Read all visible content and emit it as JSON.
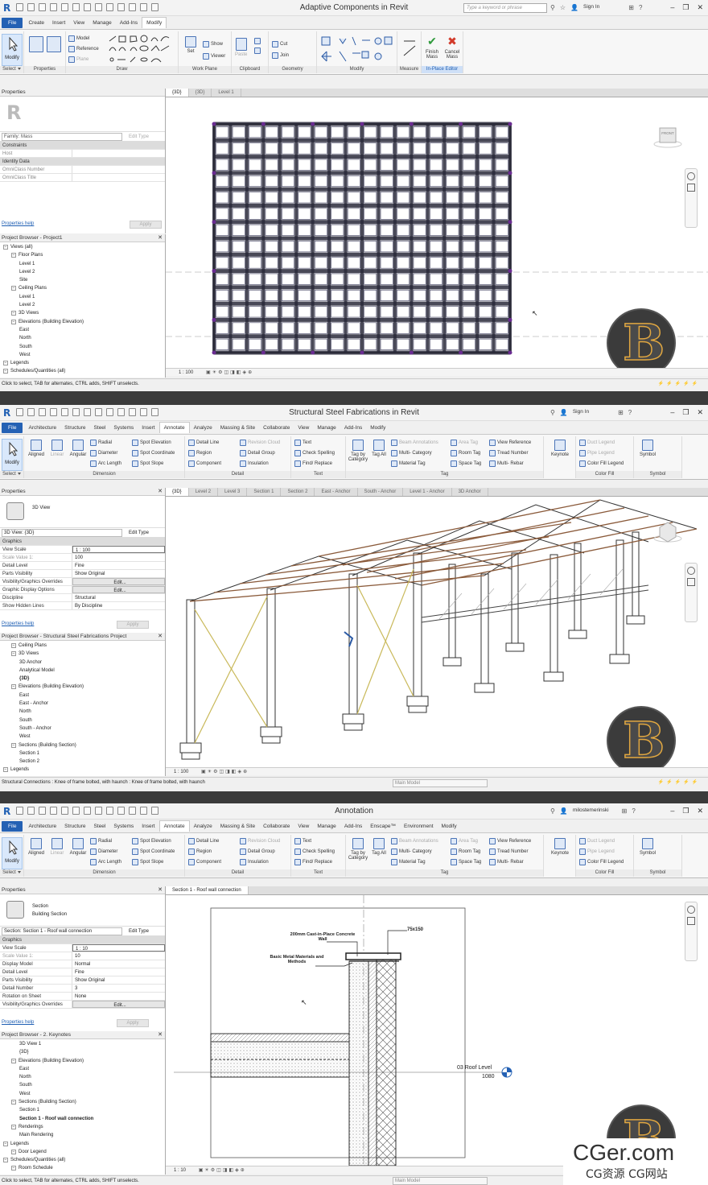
{
  "app": {
    "search_placeholder": "Type a keyword or phrase",
    "sign_in": "Sign In"
  },
  "screen1": {
    "title": "Adaptive Components in Revit",
    "menu": [
      "File",
      "Create",
      "Insert",
      "View",
      "Manage",
      "Add-Ins",
      "Modify"
    ],
    "ribbon": {
      "select_label": "Select",
      "modify_label": "Modify",
      "panels": [
        "Properties",
        "Draw",
        "Work Plane",
        "Clipboard",
        "Geometry",
        "Modify",
        "Measure",
        "In-Place Editor"
      ],
      "draw_tools": [
        "Model",
        "Reference",
        "Plane"
      ],
      "workplane_tools": [
        "Set",
        "Show",
        "Viewer"
      ],
      "clipboard_tools": [
        "Paste"
      ],
      "geometry_tools": [
        "Cut",
        "Join"
      ],
      "finish_label": "Finish Mass",
      "cancel_label": "Cancel Mass"
    },
    "properties": {
      "header": "Properties",
      "family": "Family: Mass",
      "edit_type": "Edit Type",
      "groups": [
        {
          "name": "Constraints",
          "rows": [
            [
              "Host",
              ""
            ]
          ]
        },
        {
          "name": "Identity Data",
          "rows": [
            [
              "OmniClass Number",
              ""
            ],
            [
              "OmniClass Title",
              ""
            ]
          ]
        }
      ],
      "help": "Properties help",
      "apply": "Apply"
    },
    "browser": {
      "header": "Project Browser - Project1",
      "items": [
        {
          "t": "Views (all)",
          "d": 0
        },
        {
          "t": "Floor Plans",
          "d": 1
        },
        {
          "t": "Level 1",
          "d": 2
        },
        {
          "t": "Level 2",
          "d": 2
        },
        {
          "t": "Site",
          "d": 2
        },
        {
          "t": "Ceiling Plans",
          "d": 1
        },
        {
          "t": "Level 1",
          "d": 2
        },
        {
          "t": "Level 2",
          "d": 2
        },
        {
          "t": "3D Views",
          "d": 1
        },
        {
          "t": "Elevations (Building Elevation)",
          "d": 1
        },
        {
          "t": "East",
          "d": 2
        },
        {
          "t": "North",
          "d": 2
        },
        {
          "t": "South",
          "d": 2
        },
        {
          "t": "West",
          "d": 2
        },
        {
          "t": "Legends",
          "d": 0
        },
        {
          "t": "Schedules/Quantities (all)",
          "d": 0
        }
      ]
    },
    "tabs": [
      "{3D}",
      "{3D}",
      "Level 1"
    ],
    "scale": "1 : 100",
    "viewcube": "FRONT",
    "status": "Click to select, TAB for alternates, CTRL adds, SHIFT unselects.",
    "status_right": "0"
  },
  "screen2": {
    "title": "Structural Steel Fabrications in Revit",
    "menu": [
      "File",
      "Architecture",
      "Structure",
      "Steel",
      "Systems",
      "Insert",
      "Annotate",
      "Analyze",
      "Massing & Site",
      "Collaborate",
      "View",
      "Manage",
      "Add-Ins",
      "Modify"
    ],
    "ribbon": {
      "select_label": "Select",
      "modify_label": "Modify",
      "dimension_tools": [
        "Aligned",
        "Linear",
        "Angular",
        "Radial",
        "Diameter",
        "Arc Length",
        "Spot Elevation",
        "Spot Coordinate",
        "Spot Slope"
      ],
      "detail_tools": [
        "Detail Line",
        "Region",
        "Component",
        "Revision Cloud",
        "Detail Group",
        "Insulation"
      ],
      "text_tools": [
        "Text",
        "Check Spelling",
        "Find/ Replace"
      ],
      "tag_tools": [
        "Tag by Category",
        "Tag All",
        "Beam Annotations",
        "Multi- Category",
        "Material Tag",
        "Area Tag",
        "Room Tag",
        "Space Tag",
        "View Reference",
        "Tread Number",
        "Multi- Rebar"
      ],
      "keynote": "Keynote",
      "colorfill_tools": [
        "Duct Legend",
        "Pipe Legend",
        "Color Fill Legend"
      ],
      "symbol_tools": [
        "Symbol"
      ],
      "panels": [
        "Dimension",
        "Detail",
        "Text",
        "Tag",
        "Color Fill",
        "Symbol"
      ]
    },
    "properties": {
      "header": "Properties",
      "type_name": "3D View",
      "selector": "3D View: {3D}",
      "edit_type": "Edit Type",
      "rows": [
        [
          "Graphics",
          ""
        ],
        [
          "View Scale",
          "1 : 100"
        ],
        [
          "Scale Value    1:",
          "100"
        ],
        [
          "Detail Level",
          "Fine"
        ],
        [
          "Parts Visibility",
          "Show Original"
        ],
        [
          "Visibility/Graphics Overrides",
          "Edit..."
        ],
        [
          "Graphic Display Options",
          "Edit..."
        ],
        [
          "Discipline",
          "Structural"
        ],
        [
          "Show Hidden Lines",
          "By Discipline"
        ]
      ],
      "help": "Properties help",
      "apply": "Apply"
    },
    "browser": {
      "header": "Project Browser - Structural Steel Fabrications Project",
      "items": [
        {
          "t": "Ceiling Plans",
          "d": 1
        },
        {
          "t": "3D Views",
          "d": 1
        },
        {
          "t": "3D Anchor",
          "d": 2
        },
        {
          "t": "Analytical Model",
          "d": 2
        },
        {
          "t": "{3D}",
          "d": 2,
          "b": true
        },
        {
          "t": "Elevations (Building Elevation)",
          "d": 1
        },
        {
          "t": "East",
          "d": 2
        },
        {
          "t": "East - Anchor",
          "d": 2
        },
        {
          "t": "North",
          "d": 2
        },
        {
          "t": "South",
          "d": 2
        },
        {
          "t": "South - Anchor",
          "d": 2
        },
        {
          "t": "West",
          "d": 2
        },
        {
          "t": "Sections (Building Section)",
          "d": 1
        },
        {
          "t": "Section 1",
          "d": 2
        },
        {
          "t": "Section 2",
          "d": 2
        },
        {
          "t": "Legends",
          "d": 0
        }
      ]
    },
    "tabs": [
      "{3D}",
      "Level 2",
      "Level 3",
      "Section 1",
      "Section 2",
      "East - Anchor",
      "South - Anchor",
      "Level 1 - Anchor",
      "3D Anchor"
    ],
    "scale": "1 : 100",
    "status": "Structural Connections : Knee of frame bolted, with haunch : Knee of frame bolted, with haunch",
    "model": "Main Model",
    "status_right": "0"
  },
  "screen3": {
    "title": "Annotation",
    "user": "milostemerinski",
    "menu": [
      "File",
      "Architecture",
      "Structure",
      "Steel",
      "Systems",
      "Insert",
      "Annotate",
      "Analyze",
      "Massing & Site",
      "Collaborate",
      "View",
      "Manage",
      "Add-Ins",
      "Enscape™",
      "Environment",
      "Modify"
    ],
    "ribbon": {
      "select_label": "Select",
      "modify_label": "Modify",
      "dimension_tools": [
        "Aligned",
        "Linear",
        "Angular",
        "Radial",
        "Diameter",
        "Arc Length",
        "Spot Elevation",
        "Spot Coordinate",
        "Spot Slope"
      ],
      "detail_tools": [
        "Detail Line",
        "Region",
        "Component",
        "Revision Cloud",
        "Detail Group",
        "Insulation"
      ],
      "text_tools": [
        "Text",
        "Check Spelling",
        "Find/ Replace"
      ],
      "tag_tools": [
        "Tag by Category",
        "Tag All",
        "Beam Annotations",
        "Multi- Category",
        "Material Tag",
        "Area Tag",
        "Room Tag",
        "Space Tag",
        "View Reference",
        "Tread Number",
        "Multi- Rebar"
      ],
      "keynote": "Keynote",
      "colorfill_tools": [
        "Duct Legend",
        "Pipe Legend",
        "Color Fill Legend"
      ],
      "symbol_tools": [
        "Symbol"
      ],
      "panels": [
        "Dimension",
        "Detail",
        "Text",
        "Tag",
        "Color Fill",
        "Symbol"
      ]
    },
    "properties": {
      "header": "Properties",
      "type_name": "Section",
      "type_sub": "Building Section",
      "selector": "Section: Section 1 - Roof wall connection",
      "edit_type": "Edit Type",
      "rows": [
        [
          "Graphics",
          ""
        ],
        [
          "View Scale",
          "1 : 10"
        ],
        [
          "Scale Value    1:",
          "10"
        ],
        [
          "Display Model",
          "Normal"
        ],
        [
          "Detail Level",
          "Fine"
        ],
        [
          "Parts Visibility",
          "Show Original"
        ],
        [
          "Detail Number",
          "3"
        ],
        [
          "Rotation on Sheet",
          "None"
        ],
        [
          "Visibility/Graphics Overrides",
          "Edit..."
        ]
      ],
      "help": "Properties help",
      "apply": "Apply"
    },
    "browser": {
      "header": "Project Browser - 2. Keynotes",
      "items": [
        {
          "t": "3D View 1",
          "d": 2
        },
        {
          "t": "{3D}",
          "d": 2
        },
        {
          "t": "Elevations (Building Elevation)",
          "d": 1
        },
        {
          "t": "East",
          "d": 2
        },
        {
          "t": "North",
          "d": 2
        },
        {
          "t": "South",
          "d": 2
        },
        {
          "t": "West",
          "d": 2
        },
        {
          "t": "Sections (Building Section)",
          "d": 1
        },
        {
          "t": "Section 1",
          "d": 2
        },
        {
          "t": "Section 1 - Roof wall connection",
          "d": 2,
          "b": true
        },
        {
          "t": "Renderings",
          "d": 1
        },
        {
          "t": "Main Rendering",
          "d": 2
        },
        {
          "t": "Legends",
          "d": 0
        },
        {
          "t": "Door Legend",
          "d": 1
        },
        {
          "t": "Schedules/Quantities (all)",
          "d": 0
        },
        {
          "t": "Room Schedule",
          "d": 1
        }
      ]
    },
    "tabs": [
      "Section 1 - Roof wall connection"
    ],
    "annotations": {
      "wall": "200mm Cast-in-Place Concrete Wall",
      "metal": "Basic Metal Materials and Methods",
      "size": "75x150",
      "level": "03 Roof Level",
      "elev": "1080"
    },
    "scale": "1 : 10",
    "status": "Click to select, TAB for alternates, CTRL adds, SHIFT unselects.",
    "model": "Main Model"
  },
  "watermark": {
    "line1": "CGer.com",
    "line2": "CG资源 CG网站"
  },
  "colors": {
    "file_tab": "#2461b4",
    "accent": "#1f5fb3",
    "logo_ring": "#e1a740"
  }
}
